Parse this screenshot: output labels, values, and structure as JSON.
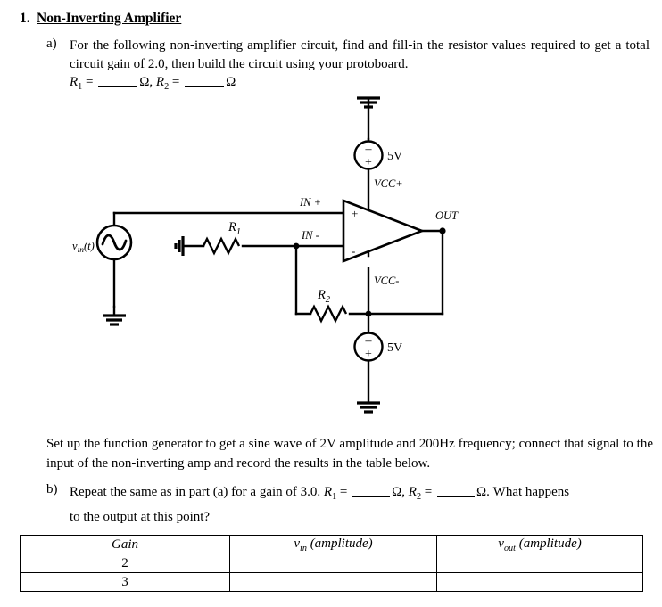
{
  "heading": {
    "number": "1.",
    "title": "Non-Inverting Amplifier"
  },
  "part_a": {
    "marker": "a)",
    "text": "For the following non-inverting amplifier circuit, find and fill-in the resistor values required to get a total circuit gain of 2.0, then build the circuit using your protoboard.",
    "resistor_prefix_r1": "R",
    "resistor_sub_1": "1",
    "equals": " = ",
    "ohm": "Ω",
    "comma": ", ",
    "resistor_prefix_r2": "R",
    "resistor_sub_2": "2",
    "gain_value": "2.0"
  },
  "circuit": {
    "source_label_v": "v",
    "source_label_sub": "in",
    "source_label_t": "(t)",
    "r1_label": "R",
    "r1_sub": "1",
    "r2_label": "R",
    "r2_sub": "2",
    "opamp_plus": "+",
    "opamp_minus": "-",
    "in_plus_label": "IN +",
    "in_minus_label": "IN -",
    "out_label": "OUT",
    "vcc_plus_label": "VCC+",
    "vcc_minus_label": "VCC-",
    "supply_top_value": "5V",
    "supply_bottom_value": "5V",
    "supply_top_minus": "–",
    "supply_top_plus": "+",
    "supply_bottom_minus": "–",
    "supply_bottom_plus": "+",
    "line_color": "#000000"
  },
  "setup_paragraph": {
    "text": "Set up the function generator to get a sine wave of 2V amplitude and 200Hz frequency; connect that signal to the input of the non-inverting amp and record the results in the table below.",
    "amplitude": "2V",
    "frequency": "200Hz"
  },
  "part_b": {
    "marker": "b)",
    "text_1": "Repeat the same as in part (a) for a gain of 3.0. ",
    "r1": "R",
    "r1_sub": "1",
    "equals": " = ",
    "ohm": "Ω",
    "comma": ", ",
    "r2": "R",
    "r2_sub": "2",
    "text_2": ". What happens",
    "text_3": "to the output at this point?",
    "gain_value": "3.0"
  },
  "table": {
    "headers": {
      "gain": "Gain",
      "vin_v": "v",
      "vin_sub": "in",
      "vin_rest": " (amplitude)",
      "vout_v": "v",
      "vout_sub": "out",
      "vout_rest": " (amplitude)"
    },
    "rows": [
      {
        "gain": "2",
        "vin": "",
        "vout": ""
      },
      {
        "gain": "3",
        "vin": "",
        "vout": ""
      }
    ]
  }
}
